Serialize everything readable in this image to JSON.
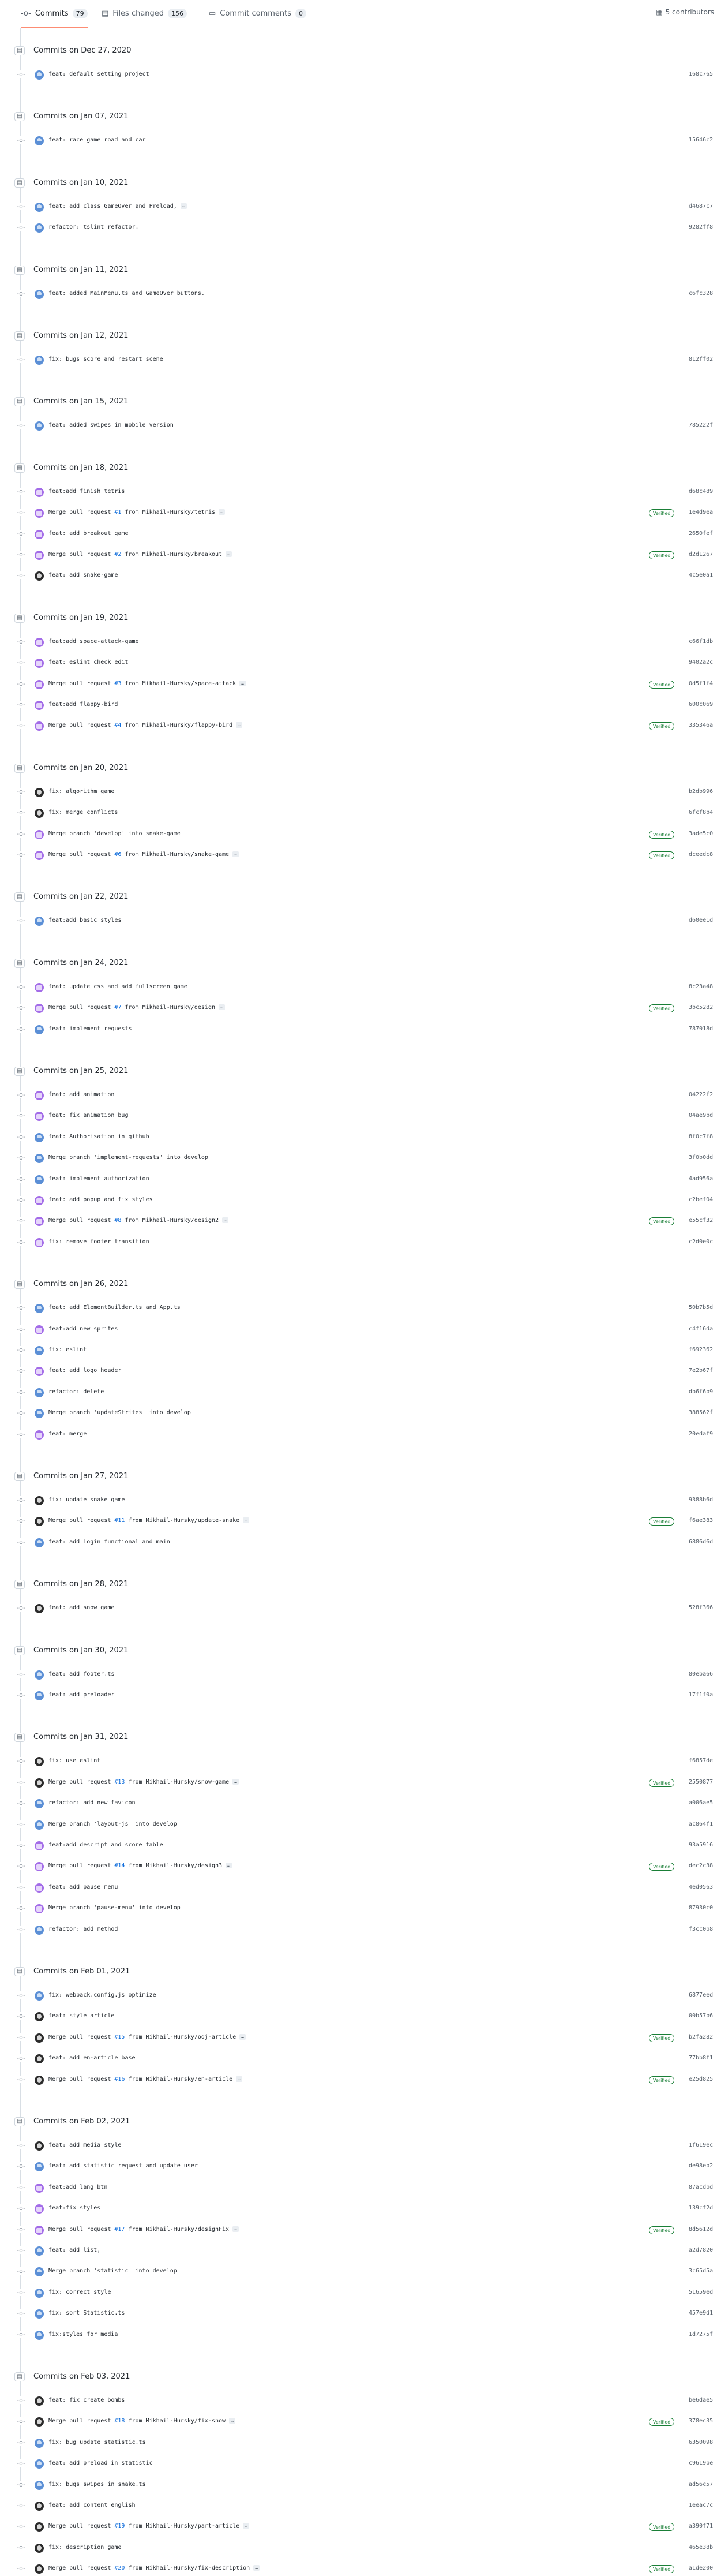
{
  "tabs": {
    "commits_label": "Commits",
    "commits_count": "79",
    "files_label": "Files changed",
    "files_count": "156",
    "comments_label": "Commit comments",
    "comments_count": "0",
    "contributors": "5 contributors"
  },
  "days": [
    {
      "date": "Commits on Dec 27, 2020",
      "commits": [
        {
          "a": 1,
          "msg": "feat: default setting project",
          "sha": "168c765"
        }
      ]
    },
    {
      "date": "Commits on Jan 07, 2021",
      "commits": [
        {
          "a": 1,
          "msg": "feat: race game road and car",
          "sha": "15646c2"
        }
      ]
    },
    {
      "date": "Commits on Jan 10, 2021",
      "commits": [
        {
          "a": 1,
          "msg": "feat: add class GameOver and Preload,",
          "more": true,
          "sha": "d4687c7"
        },
        {
          "a": 1,
          "msg": "refactor: tslint refactor.",
          "sha": "9282ff8"
        }
      ]
    },
    {
      "date": "Commits on Jan 11, 2021",
      "commits": [
        {
          "a": 1,
          "msg": "feat: added MainMenu.ts and GameOver buttons.",
          "sha": "c6fc328"
        }
      ]
    },
    {
      "date": "Commits on Jan 12, 2021",
      "commits": [
        {
          "a": 1,
          "msg": "fix: bugs score and restart scene",
          "sha": "812ff02"
        }
      ]
    },
    {
      "date": "Commits on Jan 15, 2021",
      "commits": [
        {
          "a": 1,
          "msg": "feat: added swipes in mobile version",
          "sha": "785222f"
        }
      ]
    },
    {
      "date": "Commits on Jan 18, 2021",
      "commits": [
        {
          "a": 2,
          "msg": "feat:add finish tetris",
          "sha": "d68c489"
        },
        {
          "a": 2,
          "msg": "Merge pull request ",
          "pr": "#1",
          "tail": " from Mikhail-Hursky/tetris",
          "more": true,
          "verified": true,
          "sha": "1e4d9ea"
        },
        {
          "a": 2,
          "msg": "feat: add breakout game",
          "sha": "2650fef"
        },
        {
          "a": 2,
          "msg": "Merge pull request ",
          "pr": "#2",
          "tail": " from Mikhail-Hursky/breakout",
          "more": true,
          "verified": true,
          "sha": "d2d1267"
        },
        {
          "a": 3,
          "msg": "feat: add snake-game",
          "sha": "4c5e0a1"
        }
      ]
    },
    {
      "date": "Commits on Jan 19, 2021",
      "commits": [
        {
          "a": 2,
          "msg": "feat:add space-attack-game",
          "sha": "c66f1db"
        },
        {
          "a": 2,
          "msg": "feat: eslint check edit",
          "sha": "9402a2c"
        },
        {
          "a": 2,
          "msg": "Merge pull request ",
          "pr": "#3",
          "tail": " from Mikhail-Hursky/space-attack",
          "more": true,
          "verified": true,
          "sha": "0d5f1f4"
        },
        {
          "a": 2,
          "msg": "feat:add flappy-bird",
          "sha": "600c069"
        },
        {
          "a": 2,
          "msg": "Merge pull request ",
          "pr": "#4",
          "tail": " from Mikhail-Hursky/flappy-bird",
          "more": true,
          "verified": true,
          "sha": "335346a"
        }
      ]
    },
    {
      "date": "Commits on Jan 20, 2021",
      "commits": [
        {
          "a": 3,
          "msg": "fix: algorithm game",
          "sha": "b2db996"
        },
        {
          "a": 3,
          "msg": "fix: merge conflicts",
          "sha": "6fcf8b4"
        },
        {
          "a": 2,
          "msg": "Merge branch 'develop' into snake-game",
          "verified": true,
          "sha": "3ade5c0"
        },
        {
          "a": 2,
          "msg": "Merge pull request ",
          "pr": "#6",
          "tail": " from Mikhail-Hursky/snake-game",
          "more": true,
          "verified": true,
          "sha": "dceedc8"
        }
      ]
    },
    {
      "date": "Commits on Jan 22, 2021",
      "commits": [
        {
          "a": 1,
          "msg": "feat:add basic styles",
          "sha": "d60ee1d"
        }
      ]
    },
    {
      "date": "Commits on Jan 24, 2021",
      "commits": [
        {
          "a": 2,
          "msg": "feat: update css and add fullscreen game",
          "sha": "8c23a48"
        },
        {
          "a": 2,
          "msg": "Merge pull request ",
          "pr": "#7",
          "tail": " from Mikhail-Hursky/design",
          "more": true,
          "verified": true,
          "sha": "3bc5282"
        },
        {
          "a": 1,
          "msg": "feat: implement requests",
          "sha": "787018d"
        }
      ]
    },
    {
      "date": "Commits on Jan 25, 2021",
      "commits": [
        {
          "a": 2,
          "msg": "feat: add animation",
          "sha": "04222f2"
        },
        {
          "a": 2,
          "msg": "feat: fix animation bug",
          "sha": "04ae9bd"
        },
        {
          "a": 1,
          "msg": "feat: Authorisation in github",
          "sha": "8f0c7f8"
        },
        {
          "a": 1,
          "msg": "Merge branch 'implement-requests' into develop",
          "sha": "3f0b0dd"
        },
        {
          "a": 1,
          "msg": "feat: implement authorization",
          "sha": "4ad956a"
        },
        {
          "a": 2,
          "msg": "feat: add popup and fix styles",
          "sha": "c2bef04"
        },
        {
          "a": 2,
          "msg": "Merge pull request ",
          "pr": "#8",
          "tail": " from Mikhail-Hursky/design2",
          "more": true,
          "verified": true,
          "sha": "e55cf32"
        },
        {
          "a": 2,
          "msg": "fix: remove footer transition",
          "sha": "c2d0e0c"
        }
      ]
    },
    {
      "date": "Commits on Jan 26, 2021",
      "commits": [
        {
          "a": 1,
          "msg": "feat: add ElementBuilder.ts and App.ts",
          "sha": "50b7b5d"
        },
        {
          "a": 2,
          "msg": "feat:add new sprites",
          "sha": "c4f16da"
        },
        {
          "a": 1,
          "msg": "fix: eslint",
          "sha": "f692362"
        },
        {
          "a": 2,
          "msg": "feat: add logo header",
          "sha": "7e2b67f"
        },
        {
          "a": 1,
          "msg": "refactor: delete",
          "sha": "db6f6b9"
        },
        {
          "a": 1,
          "msg": "Merge branch 'updateStrites' into develop",
          "sha": "388562f"
        },
        {
          "a": 2,
          "msg": "feat: merge",
          "sha": "20edaf9"
        }
      ]
    },
    {
      "date": "Commits on Jan 27, 2021",
      "commits": [
        {
          "a": 3,
          "msg": "fix: update snake game",
          "sha": "9388b6d"
        },
        {
          "a": 3,
          "msg": "Merge pull request ",
          "pr": "#11",
          "tail": " from Mikhail-Hursky/update-snake",
          "more": true,
          "verified": true,
          "sha": "f6ae383"
        },
        {
          "a": 1,
          "msg": "feat: add Login functional and main",
          "sha": "6886d6d"
        }
      ]
    },
    {
      "date": "Commits on Jan 28, 2021",
      "commits": [
        {
          "a": 3,
          "msg": "feat: add snow game",
          "sha": "528f366"
        }
      ]
    },
    {
      "date": "Commits on Jan 30, 2021",
      "commits": [
        {
          "a": 1,
          "msg": "feat: add footer.ts",
          "sha": "80eba66"
        },
        {
          "a": 1,
          "msg": "feat: add preloader",
          "sha": "17f1f0a"
        }
      ]
    },
    {
      "date": "Commits on Jan 31, 2021",
      "commits": [
        {
          "a": 3,
          "msg": "fix: use eslint",
          "sha": "f6857de"
        },
        {
          "a": 3,
          "msg": "Merge pull request ",
          "pr": "#13",
          "tail": " from Mikhail-Hursky/snow-game",
          "more": true,
          "verified": true,
          "sha": "2550877"
        },
        {
          "a": 1,
          "msg": "refactor: add new favicon",
          "sha": "a006ae5"
        },
        {
          "a": 1,
          "msg": "Merge branch 'layout-js' into develop",
          "sha": "ac864f1"
        },
        {
          "a": 2,
          "msg": "feat:add descript and score table",
          "sha": "93a5916"
        },
        {
          "a": 2,
          "msg": "Merge pull request ",
          "pr": "#14",
          "tail": " from Mikhail-Hursky/design3",
          "more": true,
          "verified": true,
          "sha": "dec2c38"
        },
        {
          "a": 2,
          "msg": "feat: add pause menu",
          "sha": "4ed0563"
        },
        {
          "a": 2,
          "msg": "Merge branch 'pause-menu' into develop",
          "sha": "87930c0"
        },
        {
          "a": 1,
          "msg": "refactor: add method",
          "sha": "f3cc0b8"
        }
      ]
    },
    {
      "date": "Commits on Feb 01, 2021",
      "commits": [
        {
          "a": 1,
          "msg": "fix: webpack.config.js optimize",
          "sha": "6877eed"
        },
        {
          "a": 3,
          "msg": "feat: style article",
          "sha": "00b57b6"
        },
        {
          "a": 3,
          "msg": "Merge pull request ",
          "pr": "#15",
          "tail": " from Mikhail-Hursky/odj-article",
          "more": true,
          "verified": true,
          "sha": "b2fa282"
        },
        {
          "a": 3,
          "msg": "feat: add en-article base",
          "sha": "77bb8f1"
        },
        {
          "a": 3,
          "msg": "Merge pull request ",
          "pr": "#16",
          "tail": " from Mikhail-Hursky/en-article",
          "more": true,
          "verified": true,
          "sha": "e25d825"
        }
      ]
    },
    {
      "date": "Commits on Feb 02, 2021",
      "commits": [
        {
          "a": 3,
          "msg": "feat: add media style",
          "sha": "1f619ec"
        },
        {
          "a": 1,
          "msg": "feat: add statistic request and update user",
          "sha": "de98eb2"
        },
        {
          "a": 2,
          "msg": "feat:add lang btn",
          "sha": "87acdbd"
        },
        {
          "a": 2,
          "msg": "feat:fix styles",
          "sha": "139cf2d"
        },
        {
          "a": 2,
          "msg": "Merge pull request ",
          "pr": "#17",
          "tail": " from Mikhail-Hursky/designFix",
          "more": true,
          "verified": true,
          "sha": "8d5612d"
        },
        {
          "a": 1,
          "msg": "feat: add list,",
          "sha": "a2d7820"
        },
        {
          "a": 1,
          "msg": "Merge branch 'statistic' into develop",
          "sha": "3c65d5a"
        },
        {
          "a": 1,
          "msg": "fix: correct style",
          "sha": "51659ed"
        },
        {
          "a": 1,
          "msg": "fix: sort Statistic.ts",
          "sha": "457e9d1"
        },
        {
          "a": 1,
          "msg": "fix:styles for media",
          "sha": "1d7275f"
        }
      ]
    },
    {
      "date": "Commits on Feb 03, 2021",
      "commits": [
        {
          "a": 3,
          "msg": "feat: fix create bombs",
          "sha": "be6dae5"
        },
        {
          "a": 3,
          "msg": "Merge pull request ",
          "pr": "#18",
          "tail": " from Mikhail-Hursky/fix-snow",
          "more": true,
          "verified": true,
          "sha": "378ec35"
        },
        {
          "a": 1,
          "msg": "fix: bug update statistic.ts",
          "sha": "6350098"
        },
        {
          "a": 1,
          "msg": "feat: add preload in statistic",
          "sha": "c9619be"
        },
        {
          "a": 1,
          "msg": "fix: bugs swipes in snake.ts",
          "sha": "ad56c57"
        },
        {
          "a": 3,
          "msg": "feat: add content english",
          "sha": "1eeac7c"
        },
        {
          "a": 3,
          "msg": "Merge pull request ",
          "pr": "#19",
          "tail": " from Mikhail-Hursky/part-article",
          "more": true,
          "verified": true,
          "sha": "a390f71"
        },
        {
          "a": 3,
          "msg": "fix: description game",
          "sha": "465e38b"
        },
        {
          "a": 3,
          "msg": "Merge pull request ",
          "pr": "#20",
          "tail": " from Mikhail-Hursky/fix-description",
          "more": true,
          "verified": true,
          "sha": "a1de200"
        }
      ]
    }
  ]
}
